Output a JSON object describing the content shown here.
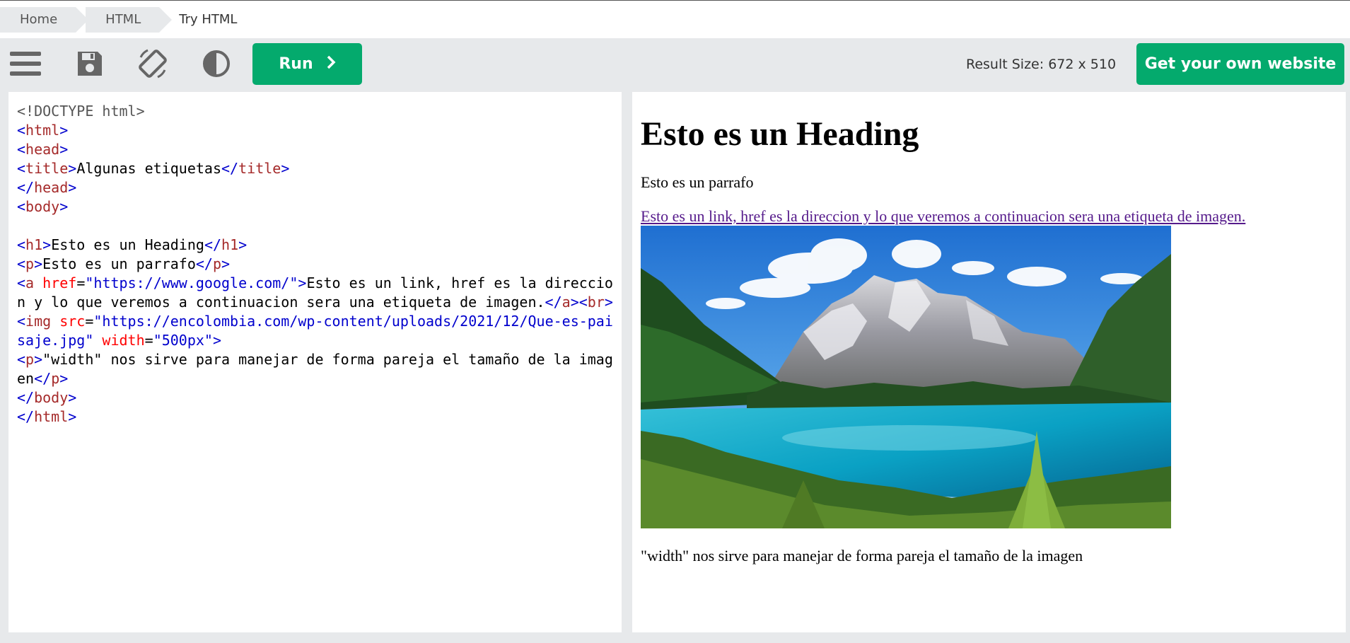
{
  "breadcrumb": {
    "items": [
      "Home",
      "HTML",
      "Try HTML"
    ]
  },
  "toolbar": {
    "icons": [
      "menu-icon",
      "save-icon",
      "rotate-icon",
      "contrast-icon"
    ],
    "run_label": "Run",
    "result_size": "Result Size: 672 x 510",
    "own_website_label": "Get your own website"
  },
  "editor": {
    "lines": [
      [
        {
          "t": "doc",
          "v": "<!DOCTYPE html>"
        }
      ],
      [
        {
          "t": "brk",
          "v": "<"
        },
        {
          "t": "tag",
          "v": "html"
        },
        {
          "t": "brk",
          "v": ">"
        }
      ],
      [
        {
          "t": "brk",
          "v": "<"
        },
        {
          "t": "tag",
          "v": "head"
        },
        {
          "t": "brk",
          "v": ">"
        }
      ],
      [
        {
          "t": "brk",
          "v": "<"
        },
        {
          "t": "tag",
          "v": "title"
        },
        {
          "t": "brk",
          "v": ">"
        },
        {
          "t": "txt",
          "v": "Algunas etiquetas"
        },
        {
          "t": "brk",
          "v": "</"
        },
        {
          "t": "tag",
          "v": "title"
        },
        {
          "t": "brk",
          "v": ">"
        }
      ],
      [
        {
          "t": "brk",
          "v": "</"
        },
        {
          "t": "tag",
          "v": "head"
        },
        {
          "t": "brk",
          "v": ">"
        }
      ],
      [
        {
          "t": "brk",
          "v": "<"
        },
        {
          "t": "tag",
          "v": "body"
        },
        {
          "t": "brk",
          "v": ">"
        }
      ],
      [],
      [
        {
          "t": "brk",
          "v": "<"
        },
        {
          "t": "tag",
          "v": "h1"
        },
        {
          "t": "brk",
          "v": ">"
        },
        {
          "t": "txt",
          "v": "Esto es un Heading"
        },
        {
          "t": "brk",
          "v": "</"
        },
        {
          "t": "tag",
          "v": "h1"
        },
        {
          "t": "brk",
          "v": ">"
        }
      ],
      [
        {
          "t": "brk",
          "v": "<"
        },
        {
          "t": "tag",
          "v": "p"
        },
        {
          "t": "brk",
          "v": ">"
        },
        {
          "t": "txt",
          "v": "Esto es un parrafo"
        },
        {
          "t": "brk",
          "v": "</"
        },
        {
          "t": "tag",
          "v": "p"
        },
        {
          "t": "brk",
          "v": ">"
        }
      ],
      [
        {
          "t": "brk",
          "v": "<"
        },
        {
          "t": "tag",
          "v": "a "
        },
        {
          "t": "attr",
          "v": "href"
        },
        {
          "t": "txt",
          "v": "="
        },
        {
          "t": "val",
          "v": "\"https://www.google.com/\""
        },
        {
          "t": "brk",
          "v": ">"
        },
        {
          "t": "txt",
          "v": "Esto es un link, href es la direccion y lo que veremos a continuacion sera una etiqueta de imagen."
        },
        {
          "t": "brk",
          "v": "</"
        },
        {
          "t": "tag",
          "v": "a"
        },
        {
          "t": "brk",
          "v": "><"
        },
        {
          "t": "tag",
          "v": "br"
        },
        {
          "t": "brk",
          "v": ">"
        }
      ],
      [
        {
          "t": "brk",
          "v": "<"
        },
        {
          "t": "tag",
          "v": "img "
        },
        {
          "t": "attr",
          "v": "src"
        },
        {
          "t": "txt",
          "v": "="
        },
        {
          "t": "val",
          "v": "\"https://encolombia.com/wp-content/uploads/2021/12/Que-es-paisaje.jpg\""
        },
        {
          "t": "txt",
          "v": " "
        },
        {
          "t": "attr",
          "v": "width"
        },
        {
          "t": "txt",
          "v": "="
        },
        {
          "t": "val",
          "v": "\"500px\""
        },
        {
          "t": "brk",
          "v": ">"
        }
      ],
      [
        {
          "t": "brk",
          "v": "<"
        },
        {
          "t": "tag",
          "v": "p"
        },
        {
          "t": "brk",
          "v": ">"
        },
        {
          "t": "txt",
          "v": "\"width\" nos sirve para manejar de forma pareja el tamaño de la imagen"
        },
        {
          "t": "brk",
          "v": "</"
        },
        {
          "t": "tag",
          "v": "p"
        },
        {
          "t": "brk",
          "v": ">"
        }
      ],
      [
        {
          "t": "brk",
          "v": "</"
        },
        {
          "t": "tag",
          "v": "body"
        },
        {
          "t": "brk",
          "v": ">"
        }
      ],
      [
        {
          "t": "brk",
          "v": "</"
        },
        {
          "t": "tag",
          "v": "html"
        },
        {
          "t": "brk",
          "v": ">"
        }
      ]
    ]
  },
  "result": {
    "heading": "Esto es un Heading",
    "paragraph": "Esto es un parrafo",
    "link": "Esto es un link, href es la direccion y lo que veremos a continuacion sera una etiqueta de imagen.",
    "image_subject": "mountain-lake-landscape",
    "caption": "\"width\" nos sirve para manejar de forma pareja el tamaño de la imagen"
  },
  "colors": {
    "accent_green": "#04aa6d",
    "toolbar_bg": "#e7e9eb",
    "link_visited": "#551a8b"
  }
}
